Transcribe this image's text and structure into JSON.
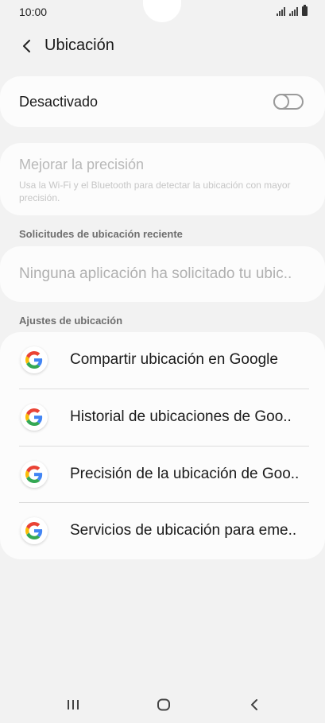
{
  "status_bar": {
    "time": "10:00"
  },
  "header": {
    "title": "Ubicación"
  },
  "location_toggle": {
    "label": "Desactivado",
    "enabled": false
  },
  "improve_accuracy": {
    "title": "Mejorar la precisión",
    "description": "Usa la Wi-Fi y el Bluetooth para detectar la ubicación con mayor precisión."
  },
  "recent_requests": {
    "section_title": "Solicitudes de ubicación reciente",
    "empty_text": "Ninguna aplicación ha solicitado tu ubic.."
  },
  "location_settings": {
    "section_title": "Ajustes de ubicación",
    "items": [
      {
        "label": "Compartir ubicación en Google",
        "icon": "google-icon"
      },
      {
        "label": "Historial de ubicaciones de Goo..",
        "icon": "google-icon"
      },
      {
        "label": "Precisión de la ubicación de Goo..",
        "icon": "google-icon"
      },
      {
        "label": "Servicios de ubicación para eme..",
        "icon": "google-icon"
      }
    ]
  },
  "colors": {
    "background": "#f2f2f2",
    "card": "#fcfcfc",
    "google_blue": "#4285F4",
    "google_red": "#EA4335",
    "google_yellow": "#FBBC05",
    "google_green": "#34A853"
  },
  "nav_bar": {
    "icons": [
      "recents-icon",
      "home-icon",
      "back-icon"
    ]
  }
}
